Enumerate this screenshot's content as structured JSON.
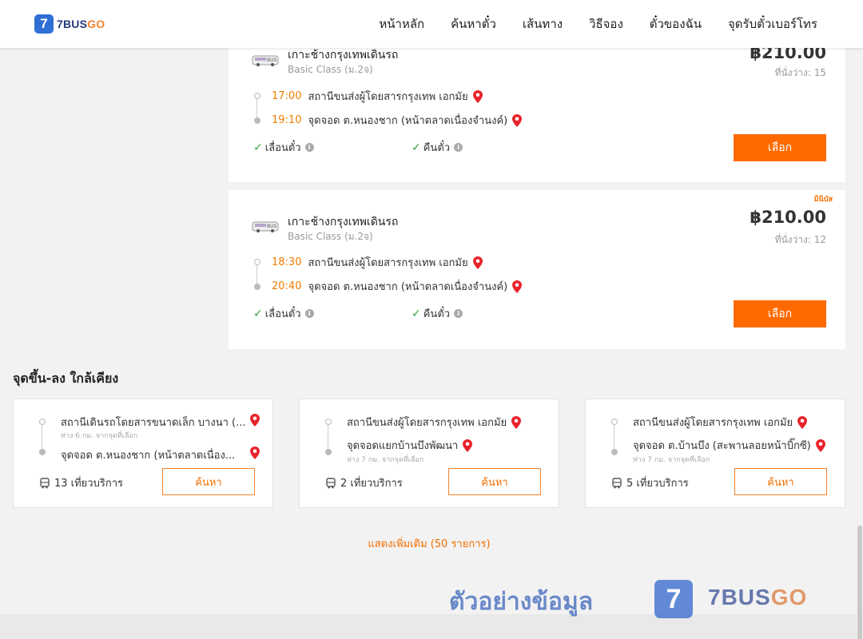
{
  "header": {
    "logo_mark": "7",
    "logo_text_a": "7BUS",
    "logo_text_b": "GO",
    "nav": [
      "หน้าหลัก",
      "ค้นหาตั๋ว",
      "เส้นทาง",
      "วิธีจอง",
      "ตั๋วของฉัน",
      "จุดรับตั๋วเบอร์โทร"
    ]
  },
  "trips": [
    {
      "operator": "เกาะช้างกรุงเทพเดินรถ",
      "class": "Basic Class (ม.2จ)",
      "price": "฿210.00",
      "seats": "ที่นั่งว่าง: 15",
      "depart_time": "17:00",
      "depart_stop": "สถานีขนส่งผู้โดยสารกรุงเทพ เอกมัย",
      "arrive_time": "19:10",
      "arrive_stop": "จุดจอด ต.หนองชาก (หน้าตลาดเนื่องจำนงค์)",
      "feature_1": "เลื่อนตั๋ว",
      "feature_2": "คืนตั๋ว",
      "button": "เลือก"
    },
    {
      "tag": "มินิบัส",
      "operator": "เกาะช้างกรุงเทพเดินรถ",
      "class": "Basic Class (ม.2จ)",
      "price": "฿210.00",
      "seats": "ที่นั่งว่าง: 12",
      "depart_time": "18:30",
      "depart_stop": "สถานีขนส่งผู้โดยสารกรุงเทพ เอกมัย",
      "arrive_time": "20:40",
      "arrive_stop": "จุดจอด ต.หนองชาก (หน้าตลาดเนื่องจำนงค์)",
      "feature_1": "เลื่อนตั๋ว",
      "feature_2": "คืนตั๋ว",
      "button": "เลือก"
    }
  ],
  "nearby": {
    "title": "จุดขึ้น-ลง ใกล้เคียง",
    "cards": [
      {
        "from": "สถานีเดินรถโดยสารขนาดเล็ก บางนา (...",
        "from_dist": "ห่าง 6 กม. จากจุดที่เลือก",
        "to": "จุดจอด ต.หนองชาก (หน้าตลาดเนื่อง...",
        "to_dist": "",
        "trips": "13 เที่ยวบริการ",
        "button": "ค้นหา"
      },
      {
        "from": "สถานีขนส่งผู้โดยสารกรุงเทพ เอกมัย",
        "from_dist": "",
        "to": "จุดจอดแยกบ้านบึงพัฒนา",
        "to_dist": "ห่าง 7 กม. จากจุดที่เลือก",
        "trips": "2 เที่ยวบริการ",
        "button": "ค้นหา"
      },
      {
        "from": "สถานีขนส่งผู้โดยสารกรุงเทพ เอกมัย",
        "from_dist": "",
        "to": "จุดจอด ต.บ้านบึง (สะพานลอยหน้าบิ๊กซี)",
        "to_dist": "ห่าง 7 กม. จากจุดที่เลือก",
        "trips": "5 เที่ยวบริการ",
        "button": "ค้นหา"
      }
    ]
  },
  "show_more": "แสดงเพิ่มเติม (50 รายการ)",
  "watermark": {
    "text": "ตัวอย่างข้อมูล",
    "mark": "7",
    "brand_a": "7BUS",
    "brand_b": "GO"
  },
  "colors": {
    "accent": "#ff6a00",
    "time": "#f07d00",
    "check": "#3aa33a",
    "pin": "#e8232a"
  }
}
